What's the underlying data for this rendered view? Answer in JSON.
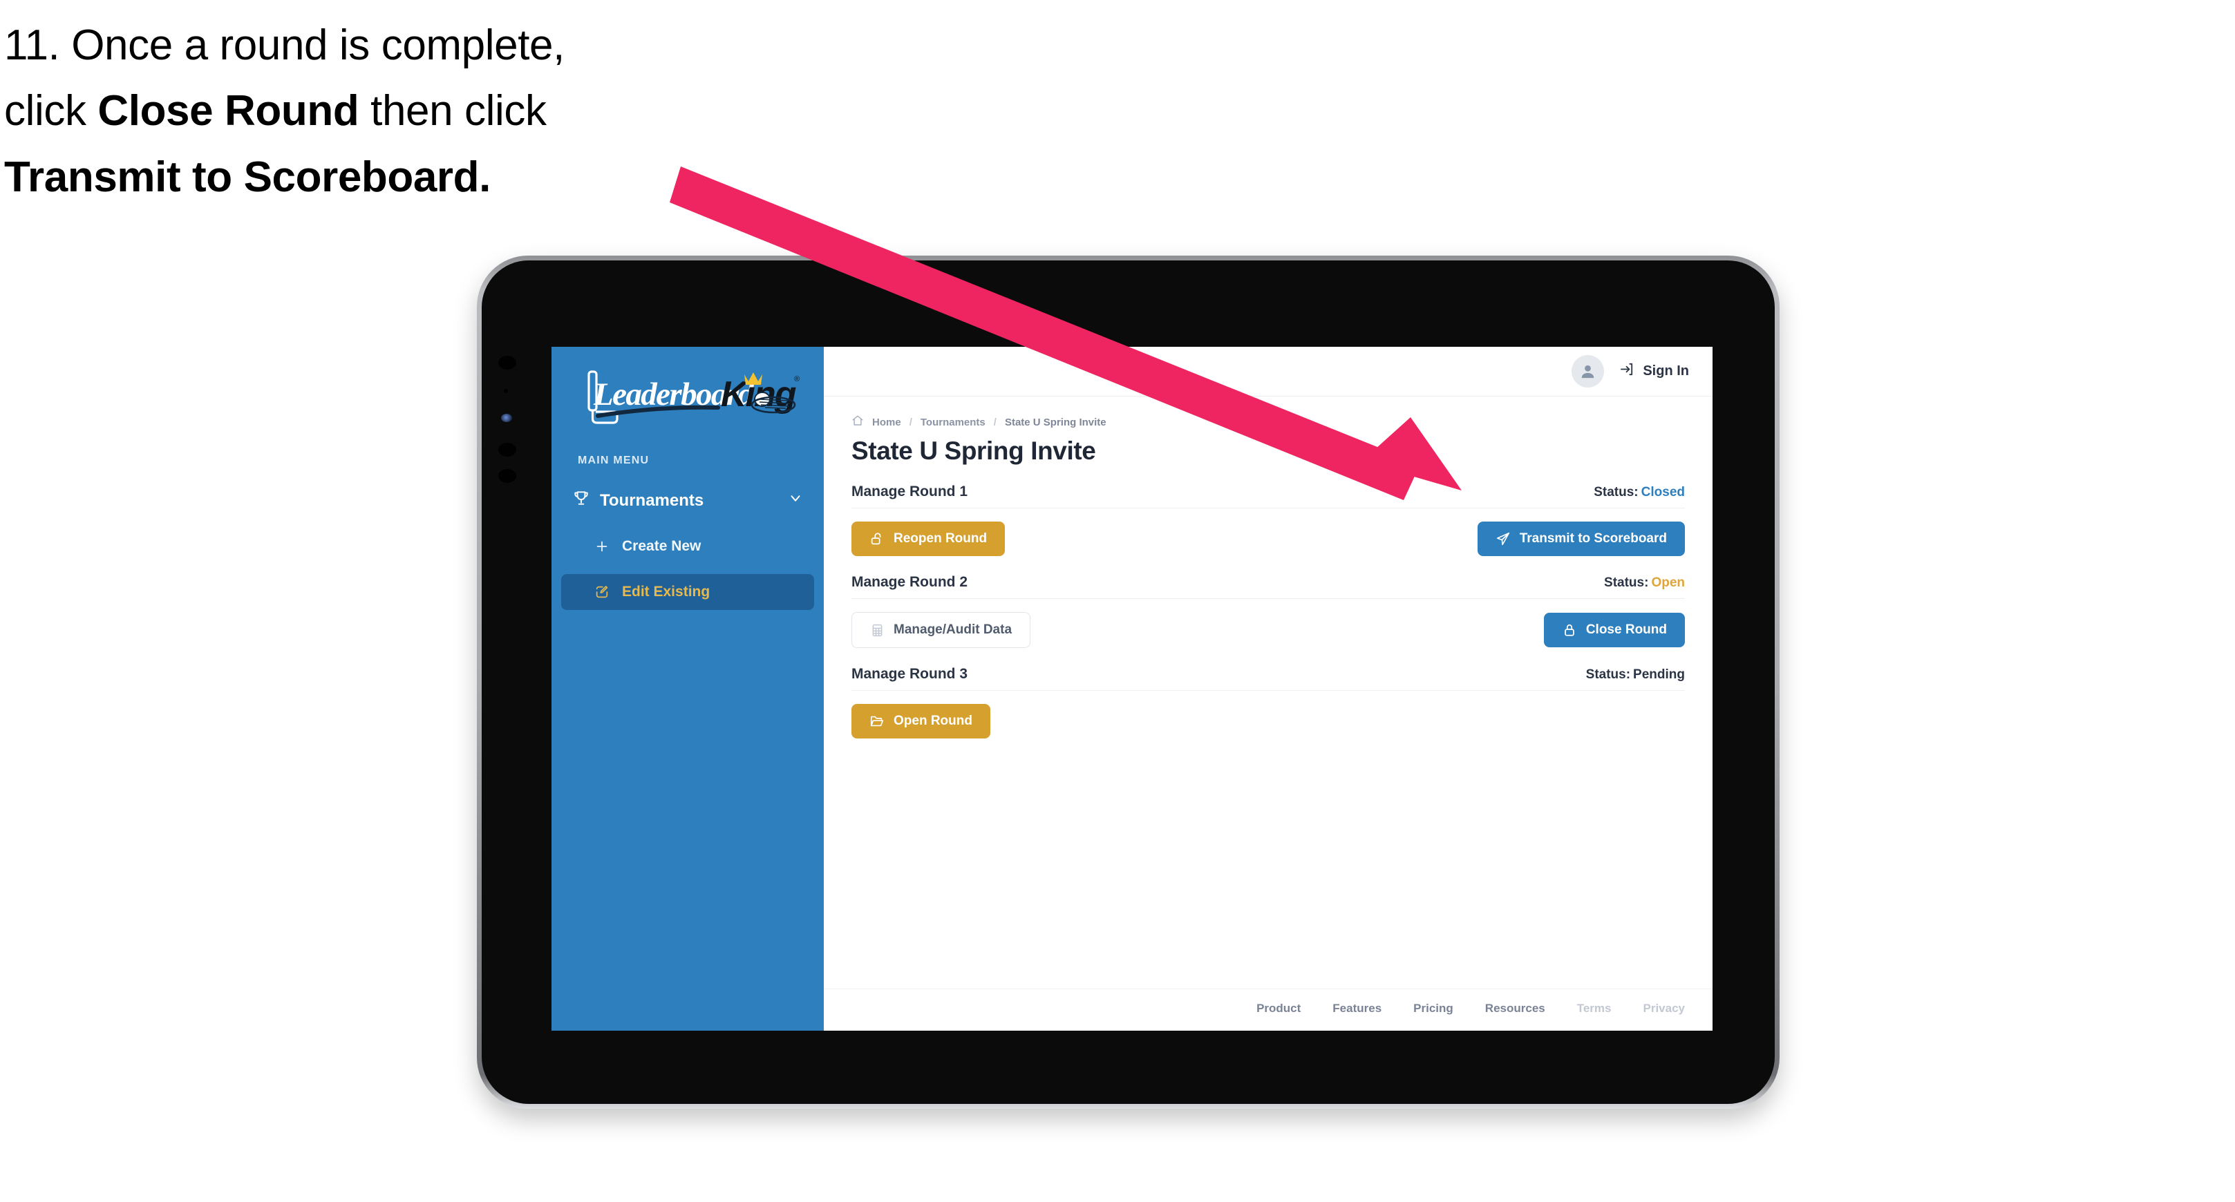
{
  "caption": {
    "line1_a": "11. Once a round is complete,",
    "line2_a": "click ",
    "line2_b": "Close Round",
    "line2_c": " then click",
    "line3_b": "Transmit to Scoreboard."
  },
  "annotation": {
    "arrow_color": "#EE2560",
    "points_to": "Transmit to Scoreboard"
  },
  "sidebar": {
    "logo_text_left": "Leaderboard",
    "logo_text_right": "King",
    "section_label": "MAIN MENU",
    "nav": {
      "label": "Tournaments",
      "icon": "trophy-icon",
      "chevron": "chevron-down-icon"
    },
    "items": [
      {
        "label": "Create New",
        "icon": "plus-icon",
        "active": false
      },
      {
        "label": "Edit Existing",
        "icon": "pencil-square-icon",
        "active": true
      }
    ],
    "bg_color": "#2E7FBD",
    "active_bg_color": "#1F6099",
    "active_text_color": "#E6B94E"
  },
  "topbar": {
    "avatar_icon": "user-avatar-icon",
    "signin_icon": "sign-in-arrow-icon",
    "signin_label": "Sign In"
  },
  "breadcrumb": {
    "home_icon": "home-icon",
    "items": [
      "Home",
      "Tournaments",
      "State U Spring Invite"
    ],
    "separator": "/"
  },
  "page_title": "State U Spring Invite",
  "rounds": [
    {
      "title": "Manage Round 1",
      "status_label": "Status:",
      "status_value": "Closed",
      "status_color": "#2E7FBD",
      "left_button": {
        "label": "Reopen Round",
        "icon": "unlock-icon",
        "style": "gold"
      },
      "right_button": {
        "label": "Transmit to Scoreboard",
        "icon": "paper-plane-icon",
        "style": "blue"
      }
    },
    {
      "title": "Manage Round 2",
      "status_label": "Status:",
      "status_value": "Open",
      "status_color": "#E0A53A",
      "left_button": {
        "label": "Manage/Audit Data",
        "icon": "table-grid-icon",
        "style": "ghost"
      },
      "right_button": {
        "label": "Close Round",
        "icon": "lock-icon",
        "style": "blue"
      }
    },
    {
      "title": "Manage Round 3",
      "status_label": "Status:",
      "status_value": "Pending",
      "status_color": "#2B3445",
      "left_button": {
        "label": "Open Round",
        "icon": "folder-open-icon",
        "style": "gold"
      },
      "right_button": null
    }
  ],
  "footer": {
    "links": [
      {
        "label": "Product",
        "dim": false
      },
      {
        "label": "Features",
        "dim": false
      },
      {
        "label": "Pricing",
        "dim": false
      },
      {
        "label": "Resources",
        "dim": false
      },
      {
        "label": "Terms",
        "dim": true
      },
      {
        "label": "Privacy",
        "dim": true
      }
    ]
  },
  "cursor": {
    "type": "pointing-hand-cursor"
  }
}
